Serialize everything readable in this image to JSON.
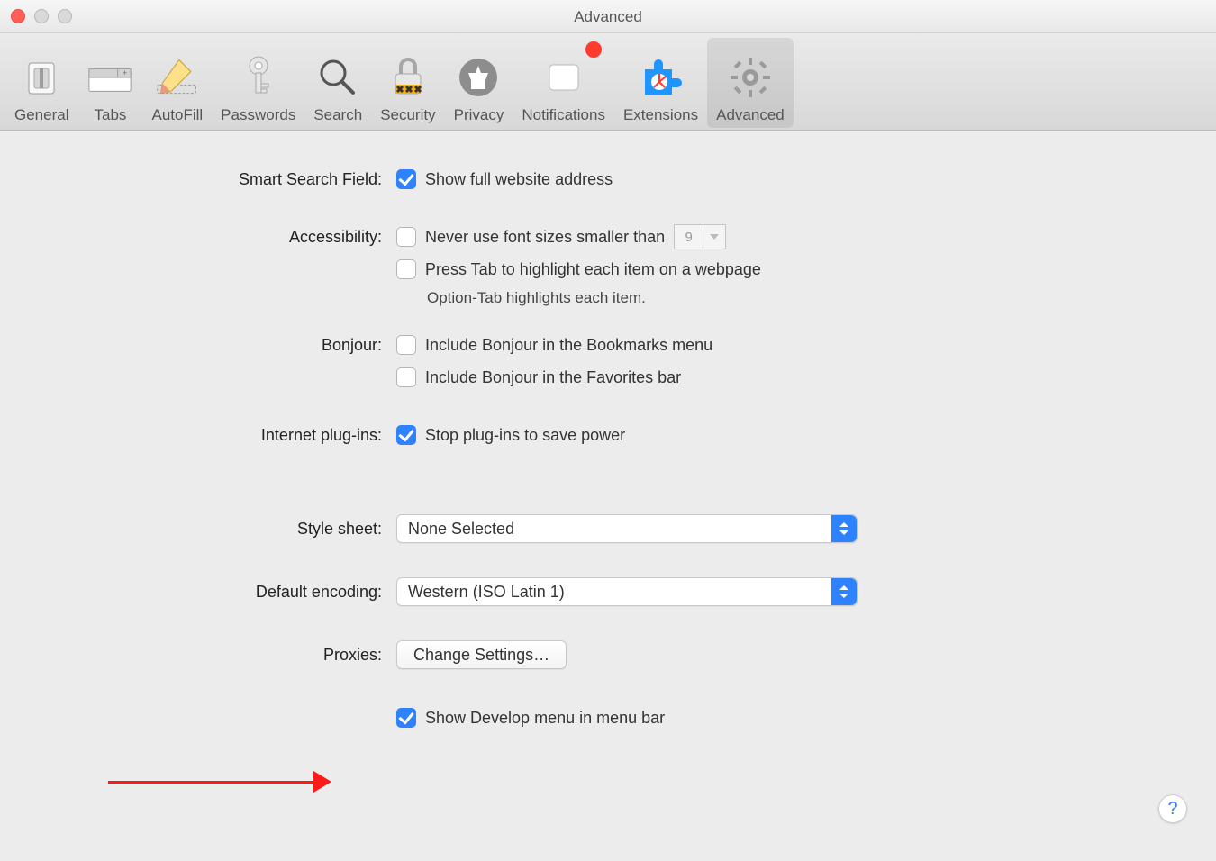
{
  "window": {
    "title": "Advanced"
  },
  "toolbar": [
    {
      "key": "general",
      "label": "General"
    },
    {
      "key": "tabs",
      "label": "Tabs"
    },
    {
      "key": "autofill",
      "label": "AutoFill"
    },
    {
      "key": "passwords",
      "label": "Passwords"
    },
    {
      "key": "search",
      "label": "Search"
    },
    {
      "key": "security",
      "label": "Security"
    },
    {
      "key": "privacy",
      "label": "Privacy"
    },
    {
      "key": "notifications",
      "label": "Notifications"
    },
    {
      "key": "extensions",
      "label": "Extensions"
    },
    {
      "key": "advanced",
      "label": "Advanced"
    }
  ],
  "toolbar_selected": "advanced",
  "notifications_badge": true,
  "sections": {
    "smart_search": {
      "label": "Smart Search Field:",
      "show_full_url": {
        "checked": true,
        "text": "Show full website address"
      }
    },
    "accessibility": {
      "label": "Accessibility:",
      "min_font": {
        "checked": false,
        "text": "Never use font sizes smaller than",
        "value": "9"
      },
      "press_tab": {
        "checked": false,
        "text": "Press Tab to highlight each item on a webpage"
      },
      "hint": "Option-Tab highlights each item."
    },
    "bonjour": {
      "label": "Bonjour:",
      "bookmarks": {
        "checked": false,
        "text": "Include Bonjour in the Bookmarks menu"
      },
      "favorites": {
        "checked": false,
        "text": "Include Bonjour in the Favorites bar"
      }
    },
    "plugins": {
      "label": "Internet plug-ins:",
      "stop_plugins": {
        "checked": true,
        "text": "Stop plug-ins to save power"
      }
    },
    "style_sheet": {
      "label": "Style sheet:",
      "value": "None Selected"
    },
    "default_encoding": {
      "label": "Default encoding:",
      "value": "Western (ISO Latin 1)"
    },
    "proxies": {
      "label": "Proxies:",
      "button": "Change Settings…"
    },
    "develop": {
      "checked": true,
      "text": "Show Develop menu in menu bar"
    }
  },
  "help_button": "?"
}
